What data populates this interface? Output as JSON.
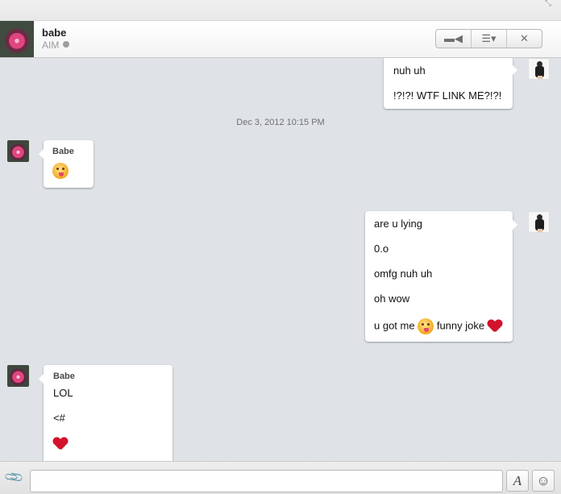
{
  "window": {
    "resize_icon": "resize-diagonal-icon"
  },
  "header": {
    "contact_name": "babe",
    "service": "AIM",
    "buttons": {
      "video": "▬◀",
      "menu": "☰▾",
      "close": "✕"
    }
  },
  "chat": {
    "timestamp": "Dec 3, 2012 10:15 PM",
    "messages": [
      {
        "from": "me",
        "lines": [
          "nuh uh",
          "!?!?! WTF LINK ME?!?!"
        ]
      },
      {
        "from": "Babe",
        "sender": "Babe",
        "lines": [
          "tongue-emoji"
        ]
      },
      {
        "from": "me",
        "lines": [
          "are u lying",
          "0.o",
          "omfg nuh uh",
          "oh wow",
          "u got me",
          "funny joke"
        ]
      },
      {
        "from": "Babe",
        "sender": "Babe",
        "lines": [
          "LOL",
          "<#",
          "heart-emoji"
        ]
      }
    ]
  },
  "input": {
    "placeholder": "",
    "value": "",
    "font_label": "A",
    "smiley_label": "☺"
  },
  "colors": {
    "background": "#dfe3e7",
    "bubble": "#ffffff",
    "heart": "#d3132b"
  }
}
